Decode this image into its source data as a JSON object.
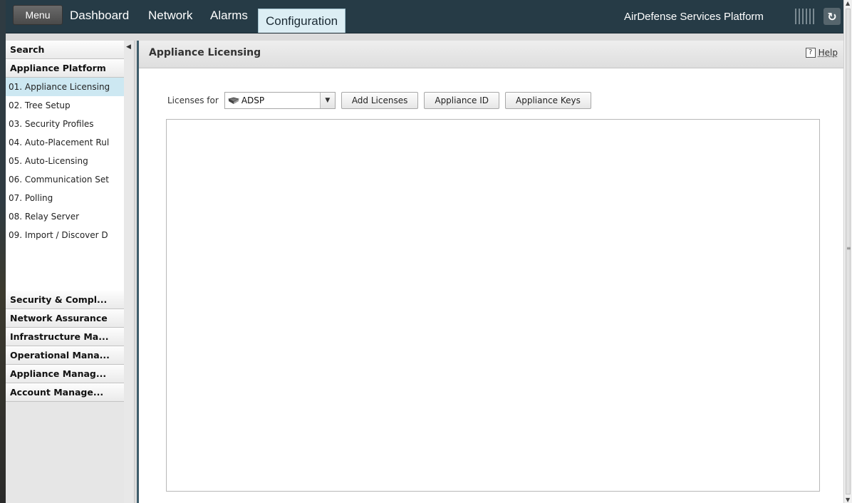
{
  "topnav": {
    "menu_label": "Menu",
    "tabs": [
      {
        "label": "Dashboard"
      },
      {
        "label": "Network"
      },
      {
        "label": "Alarms"
      },
      {
        "label": "Configuration"
      }
    ],
    "active_tab": "Configuration",
    "platform_title": "AirDefense Services Platform",
    "refresh_icon": "refresh-icon"
  },
  "sidebar": {
    "search_label": "Search",
    "sections": {
      "appliance_platform": "Appliance Platform",
      "security": "Security & Compl...",
      "network_assurance": "Network Assurance",
      "infrastructure": "Infrastructure Ma...",
      "operational": "Operational Mana...",
      "appliance_manag": "Appliance Manag...",
      "account": "Account Manage..."
    },
    "items": [
      {
        "label": "01. Appliance Licensing"
      },
      {
        "label": "02. Tree Setup"
      },
      {
        "label": "03. Security Profiles"
      },
      {
        "label": "04. Auto-Placement Rul"
      },
      {
        "label": "05. Auto-Licensing"
      },
      {
        "label": "06. Communication Set"
      },
      {
        "label": "07. Polling"
      },
      {
        "label": "08. Relay Server"
      },
      {
        "label": "09. Import / Discover D"
      }
    ],
    "selected_item": "01. Appliance Licensing"
  },
  "main": {
    "title": "Appliance Licensing",
    "help_label": "Help",
    "help_icon_glyph": "?",
    "licenses_for_label": "Licenses for",
    "licenses_for_value": "ADSP",
    "buttons": {
      "add_licenses": "Add Licenses",
      "appliance_id": "Appliance ID",
      "appliance_keys": "Appliance Keys"
    }
  },
  "colors": {
    "topbar": "#263b46",
    "active_tab": "#dceef4",
    "selected_item": "#cde8f2",
    "main_border": "#3f5d6b"
  }
}
